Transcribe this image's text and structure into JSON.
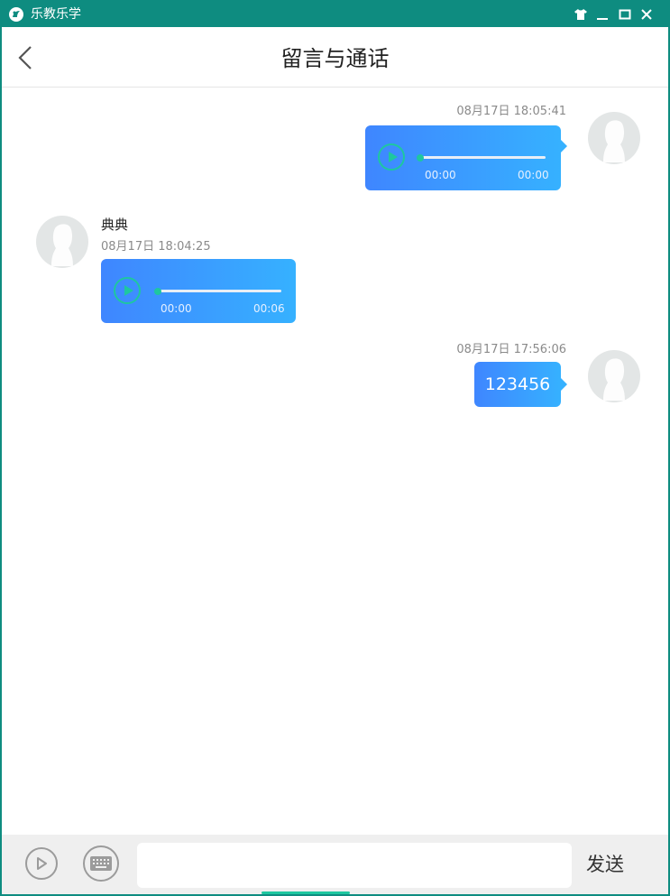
{
  "window": {
    "title": "乐教乐学",
    "accent": "#0e8c80",
    "controls": [
      "shirt-icon",
      "minimize-icon",
      "maximize-icon",
      "close-icon"
    ]
  },
  "header": {
    "title": "留言与通话",
    "back_icon": "chevron-left-icon"
  },
  "messages": [
    {
      "side": "right",
      "type": "voice",
      "timestamp": "08月17日 18:05:41",
      "current": "00:00",
      "duration": "00:00",
      "progress": 0
    },
    {
      "side": "left",
      "type": "voice",
      "sender": "典典",
      "timestamp": "08月17日 18:04:25",
      "current": "00:00",
      "duration": "00:06",
      "progress": 0
    },
    {
      "side": "right",
      "type": "text",
      "timestamp": "08月17日 17:56:06",
      "text": "123456"
    }
  ],
  "footer": {
    "voice_icon": "play-circle-icon",
    "keyboard_icon": "keyboard-icon",
    "input_value": "",
    "send_label": "发送"
  },
  "colors": {
    "bubble_start": "#3f86ff",
    "bubble_end": "#36b1ff",
    "player_accent": "#1ec7a0"
  }
}
